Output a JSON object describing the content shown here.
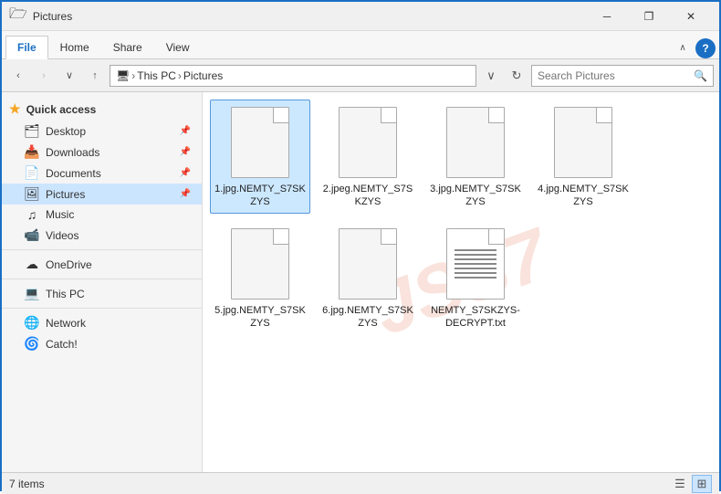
{
  "titlebar": {
    "title": "Pictures",
    "minimize_label": "─",
    "restore_label": "❐",
    "close_label": "✕"
  },
  "ribbon": {
    "tabs": [
      "File",
      "Home",
      "Share",
      "View"
    ],
    "active_tab": "File"
  },
  "toolbar": {
    "back_disabled": false,
    "forward_disabled": true,
    "up_label": "↑",
    "path": {
      "thispc": "This PC",
      "pictures": "Pictures"
    },
    "search_placeholder": "Search Pictures",
    "help_label": "?"
  },
  "sidebar": {
    "quick_access_label": "Quick access",
    "items": [
      {
        "id": "desktop",
        "label": "Desktop",
        "icon": "🗂",
        "pinned": true
      },
      {
        "id": "downloads",
        "label": "Downloads",
        "icon": "📥",
        "pinned": true
      },
      {
        "id": "documents",
        "label": "Documents",
        "icon": "📄",
        "pinned": true
      },
      {
        "id": "pictures",
        "label": "Pictures",
        "icon": "🖼",
        "pinned": true,
        "active": true
      },
      {
        "id": "music",
        "label": "Music",
        "icon": "♫",
        "pinned": false
      },
      {
        "id": "videos",
        "label": "Videos",
        "icon": "📹",
        "pinned": false
      }
    ],
    "other_items": [
      {
        "id": "onedrive",
        "label": "OneDrive",
        "icon": "☁"
      },
      {
        "id": "thispc",
        "label": "This PC",
        "icon": "💻"
      },
      {
        "id": "network",
        "label": "Network",
        "icon": "🌐"
      },
      {
        "id": "catch",
        "label": "Catch!",
        "icon": "🌀"
      }
    ]
  },
  "files": [
    {
      "id": "file1",
      "name": "1.jpg.NEMTY_S7SKZYS",
      "type": "generic",
      "selected": true
    },
    {
      "id": "file2",
      "name": "2.jpeg.NEMTY_S7SKZYS",
      "type": "generic",
      "selected": false
    },
    {
      "id": "file3",
      "name": "3.jpg.NEMTY_S7SKZYS",
      "type": "generic",
      "selected": false
    },
    {
      "id": "file4",
      "name": "4.jpg.NEMTY_S7SKZYS",
      "type": "generic",
      "selected": false
    },
    {
      "id": "file5",
      "name": "5.jpg.NEMTY_S7SKZYS",
      "type": "generic",
      "selected": false
    },
    {
      "id": "file6",
      "name": "6.jpg.NEMTY_S7SKZYS",
      "type": "generic",
      "selected": false
    },
    {
      "id": "file7",
      "name": "NEMTY_S7SKZYS-DECRYPT.txt",
      "type": "txt",
      "selected": false
    }
  ],
  "watermark": "JSS7",
  "statusbar": {
    "count_label": "7 items",
    "view_list": "☰",
    "view_icons": "⊞"
  }
}
